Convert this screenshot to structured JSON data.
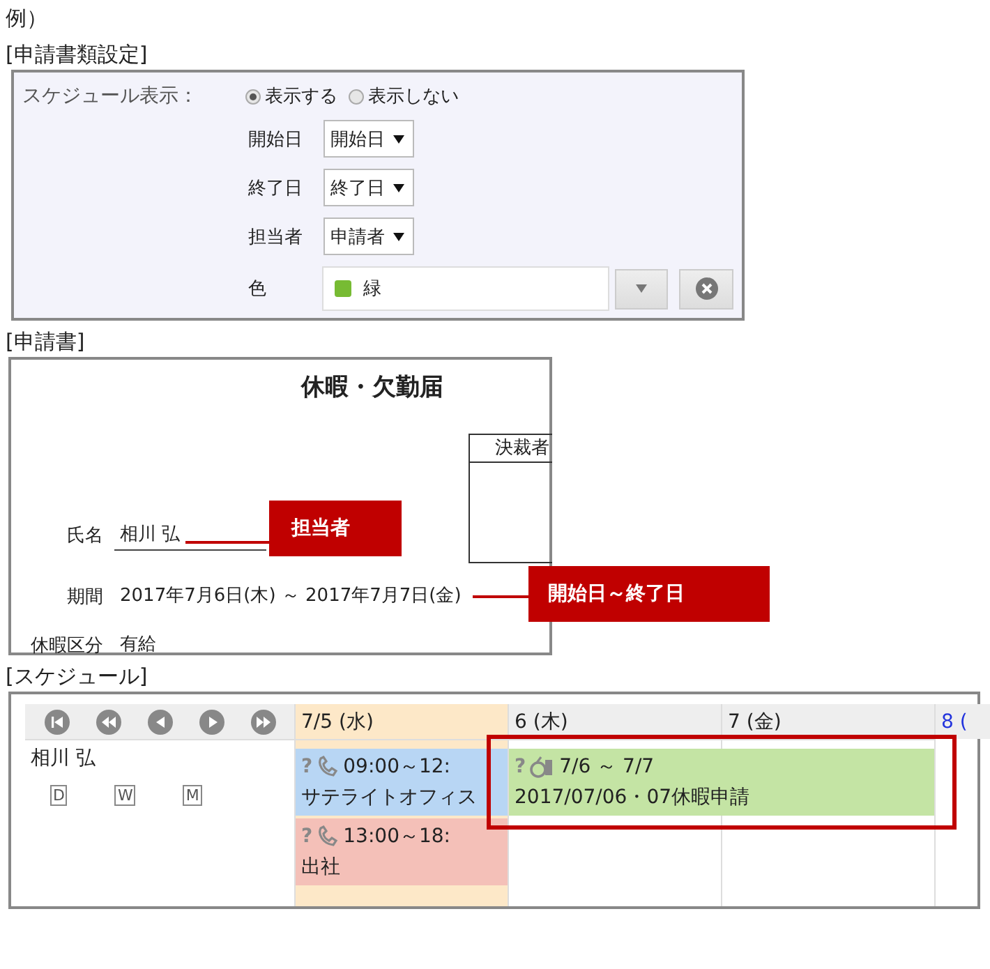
{
  "caption": "例）",
  "settings": {
    "heading": "[申請書類設定]",
    "label": "スケジュール表示：",
    "radios": [
      {
        "label": "表示する",
        "selected": true
      },
      {
        "label": "表示しない",
        "selected": false
      }
    ],
    "selects": [
      {
        "label": "開始日",
        "value": "開始日"
      },
      {
        "label": "終了日",
        "value": "終了日"
      },
      {
        "label": "担当者",
        "value": "申請者"
      }
    ],
    "color_field": {
      "label": "色",
      "value": "緑",
      "color": "#77bb33"
    }
  },
  "form": {
    "heading": "[申請書]",
    "title": "休暇・欠勤届",
    "approver": "決裁者",
    "fields": [
      {
        "label": "氏名",
        "value": "相川 弘",
        "underlined": true,
        "callout": "担当者"
      },
      {
        "label": "期間",
        "value": "2017年7月6日(木) ～ 2017年7月7日(金)",
        "underlined": false,
        "callout": "開始日～終了日"
      },
      {
        "label": "休暇区分",
        "value": "有給",
        "underlined": false
      }
    ]
  },
  "schedule": {
    "heading": "[スケジュール]",
    "days": [
      {
        "label": "7/5 (水)",
        "kind": "today"
      },
      {
        "label": "6 (木)",
        "kind": "weekday"
      },
      {
        "label": "7 (金)",
        "kind": "weekday"
      },
      {
        "label": "8 (",
        "kind": "saturday"
      }
    ],
    "user": "相川 弘",
    "views": [
      "D",
      "W",
      "M"
    ],
    "events": [
      {
        "kind": "meeting",
        "mark": "?",
        "time": "09:00～12:",
        "title": "サテライトオフィス",
        "color": "#b8d6f4",
        "highlighted": false
      },
      {
        "kind": "meeting",
        "mark": "?",
        "time": "13:00～18:",
        "title": "出社",
        "color": "#f4c0b8",
        "highlighted": false
      },
      {
        "kind": "leave",
        "mark": "?",
        "time": "7/6 ～ 7/7",
        "title": "2017/07/06・07休暇申請",
        "color": "#c4e4a4",
        "highlighted": true
      }
    ]
  }
}
